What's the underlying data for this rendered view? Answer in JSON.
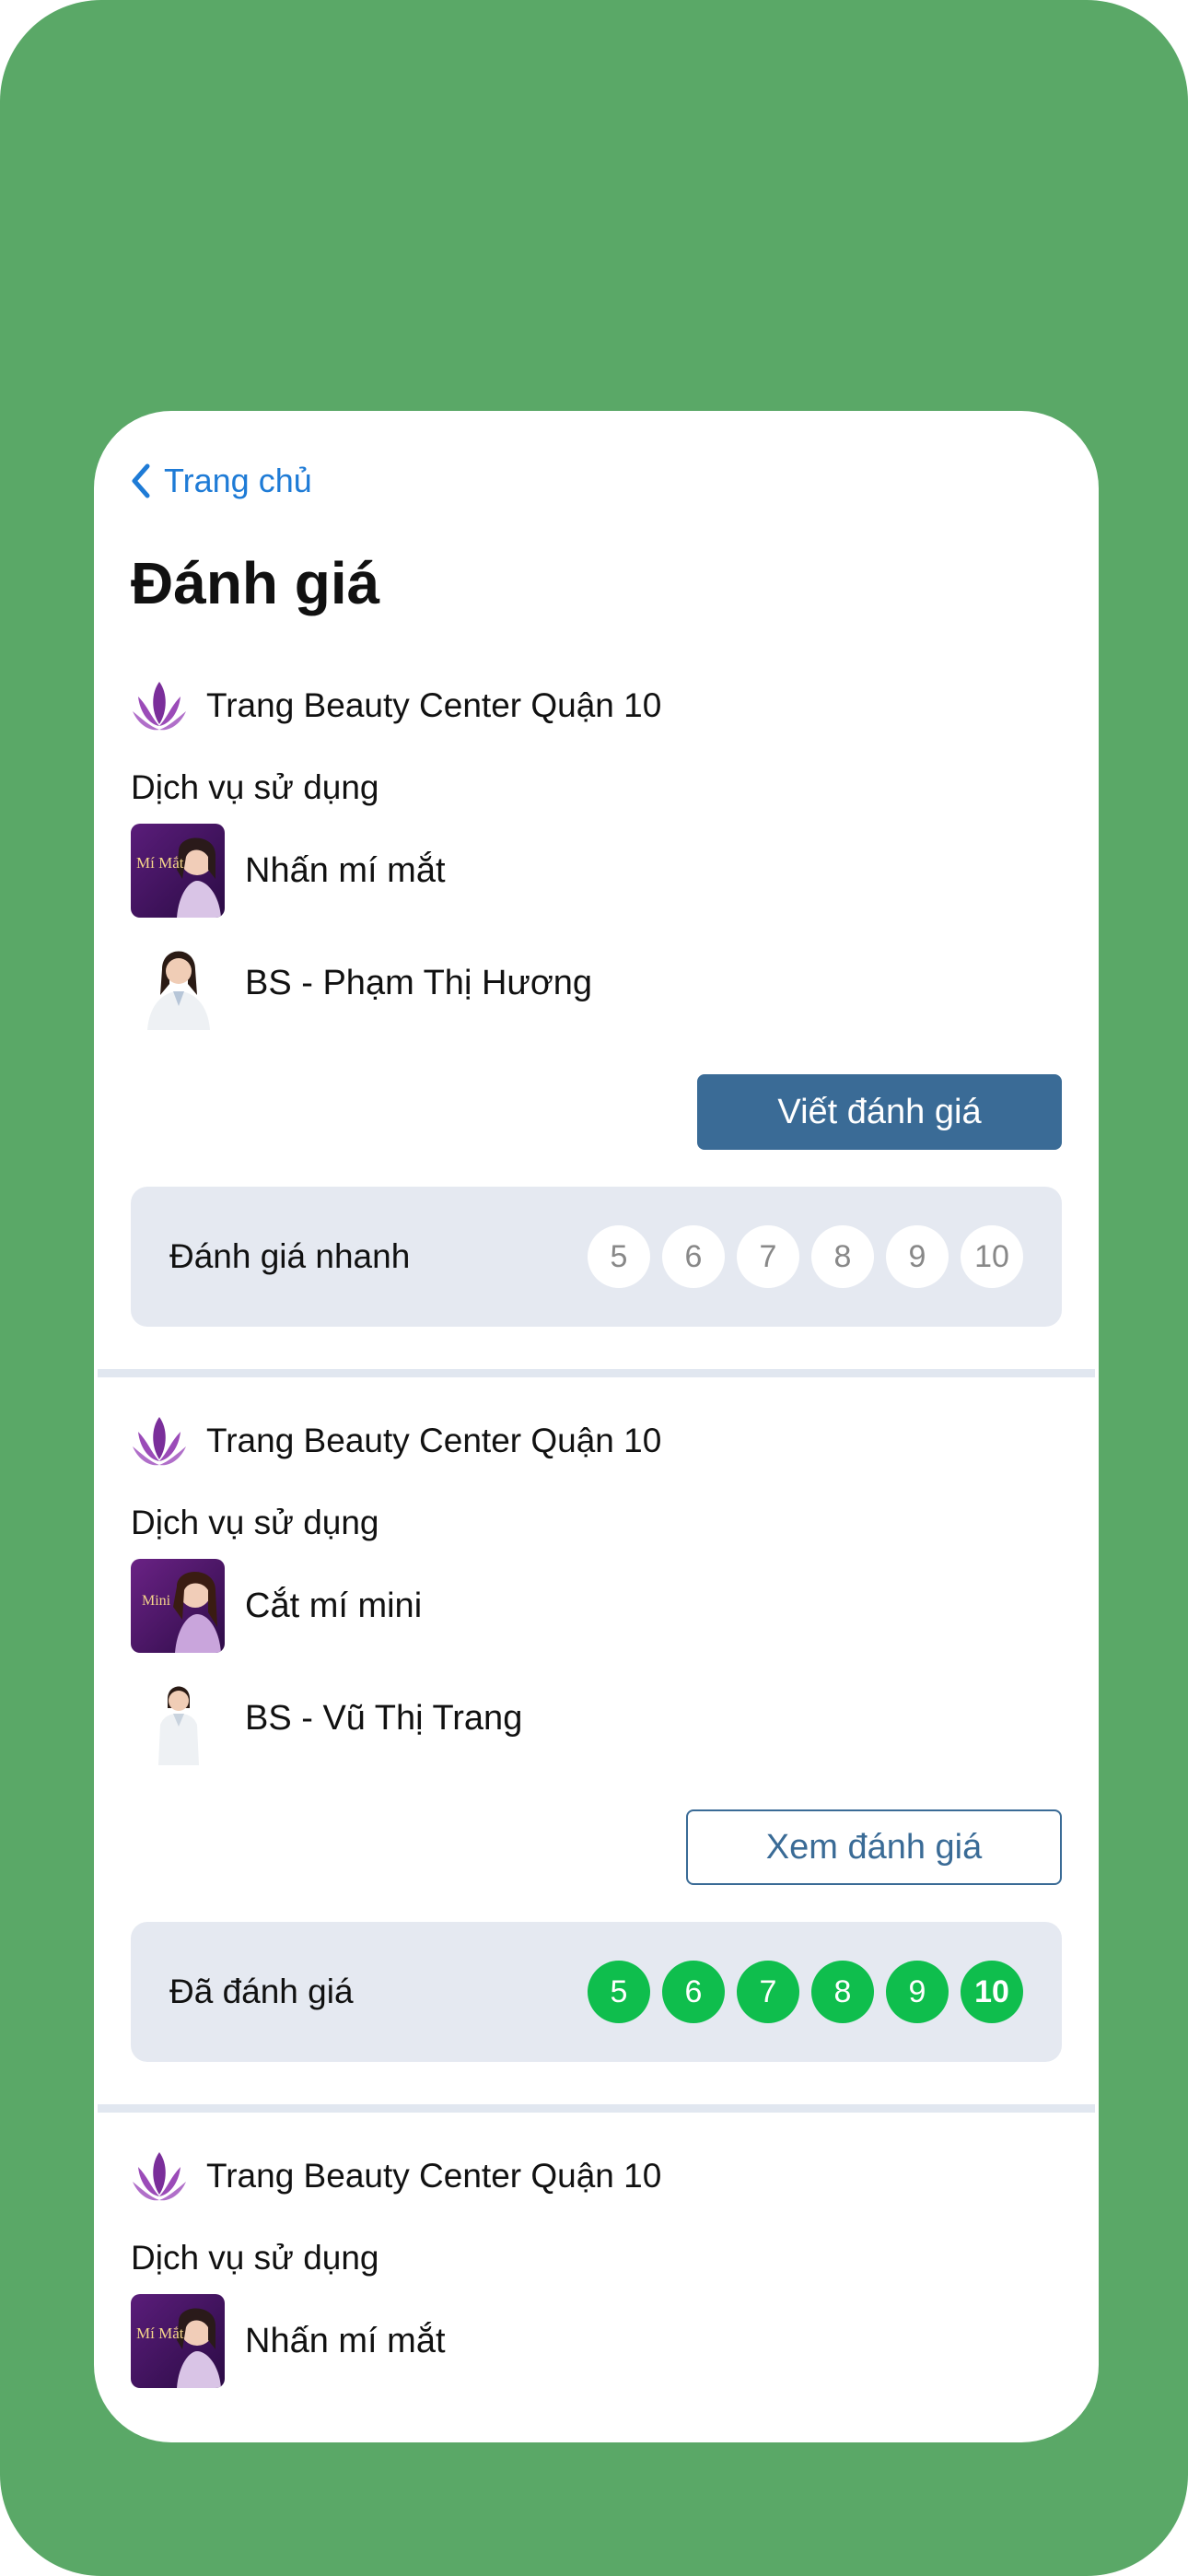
{
  "nav": {
    "back_label": "Trang chủ"
  },
  "page": {
    "title": "Đánh giá"
  },
  "cards": [
    {
      "center": "Trang Beauty Center Quận 10",
      "services_label": "Dịch vụ sử dụng",
      "service": "Nhấn mí mắt",
      "service_thumb_text": "Mí Mắt",
      "doctor": "BS - Phạm Thị Hương",
      "action_label": "Viết đánh giá",
      "rating_label": "Đánh giá nhanh",
      "scores": [
        "5",
        "6",
        "7",
        "8",
        "9",
        "10"
      ]
    },
    {
      "center": "Trang Beauty Center Quận 10",
      "services_label": "Dịch vụ sử dụng",
      "service": "Cắt mí mini",
      "service_thumb_text": "Mini",
      "doctor": "BS - Vũ Thị Trang",
      "action_label": "Xem đánh giá",
      "rating_label": "Đã đánh giá",
      "scores": [
        "5",
        "6",
        "7",
        "8",
        "9",
        "10"
      ],
      "selected_score": "10"
    },
    {
      "center": "Trang Beauty Center Quận 10",
      "services_label": "Dịch vụ sử dụng",
      "service": "Nhấn mí mắt",
      "service_thumb_text": "Mí Mắt"
    }
  ],
  "colors": {
    "frame": "#5aa867",
    "link": "#1e7bd6",
    "primary_button": "#3a6b96",
    "rating_box": "#e5e9f1",
    "score_selected": "#0fbe4d",
    "logo": "#7a2e9a"
  }
}
